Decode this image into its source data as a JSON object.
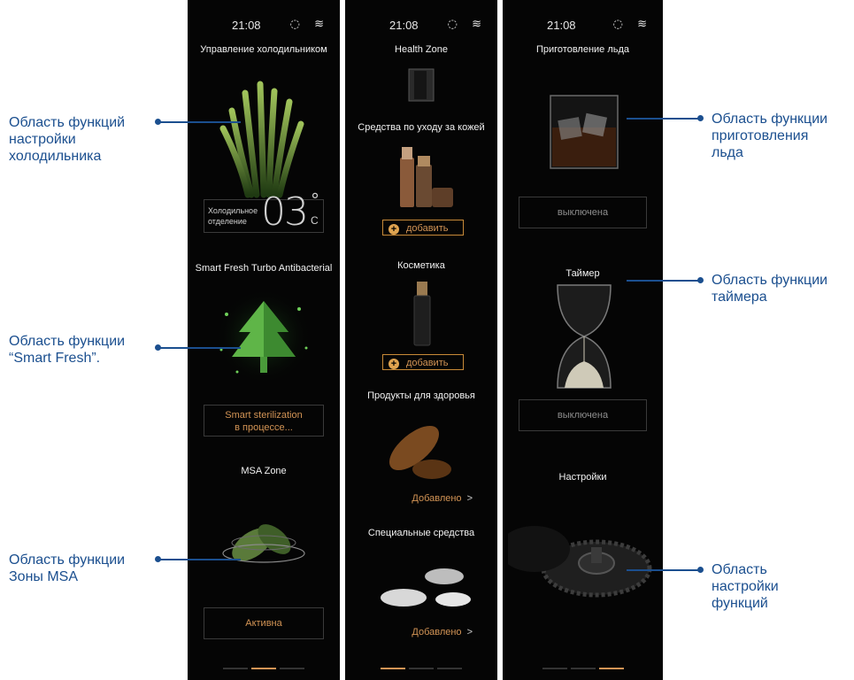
{
  "status": {
    "time": "21:08"
  },
  "screen1": {
    "title": "Управление холодильником",
    "fridge_label": "Холодильное отделение",
    "temp_value": "03",
    "temp_unit_deg": "°",
    "temp_unit": "C",
    "smart_fresh_title": "Smart Fresh Turbo Antibacterial",
    "smart_status_line1": "Smart sterilization",
    "smart_status_line2": "в процессе...",
    "msa_title": "MSA Zone",
    "msa_status": "Активна"
  },
  "screen2": {
    "health_title": "Health Zone",
    "skin_title": "Средства по уходу за кожей",
    "add_label": "добавить",
    "cosmetics_title": "Косметика",
    "health_products_title": "Продукты для здоровья",
    "added_label": "Добавлено",
    "special_title": "Специальные средства"
  },
  "screen3": {
    "ice_title": "Приготовление льда",
    "ice_status": "выключена",
    "timer_title": "Таймер",
    "timer_status": "выключена",
    "settings_title": "Настройки"
  },
  "annotations": {
    "fridge_settings": [
      "Область функций",
      "настройки",
      "холодильника"
    ],
    "smart_fresh": [
      "Область функции",
      "“Smart Fresh”."
    ],
    "msa_zone": [
      "Область функции",
      "Зоны MSA"
    ],
    "ice_making": [
      "Область функции",
      "приготовления",
      "льда"
    ],
    "timer": [
      "Область функции",
      "таймера"
    ],
    "function_settings": [
      "Область",
      "настройки",
      "функций"
    ]
  },
  "colors": {
    "accent": "#d39455",
    "annotation": "#1b4f8f",
    "screen_bg": "#050505"
  }
}
